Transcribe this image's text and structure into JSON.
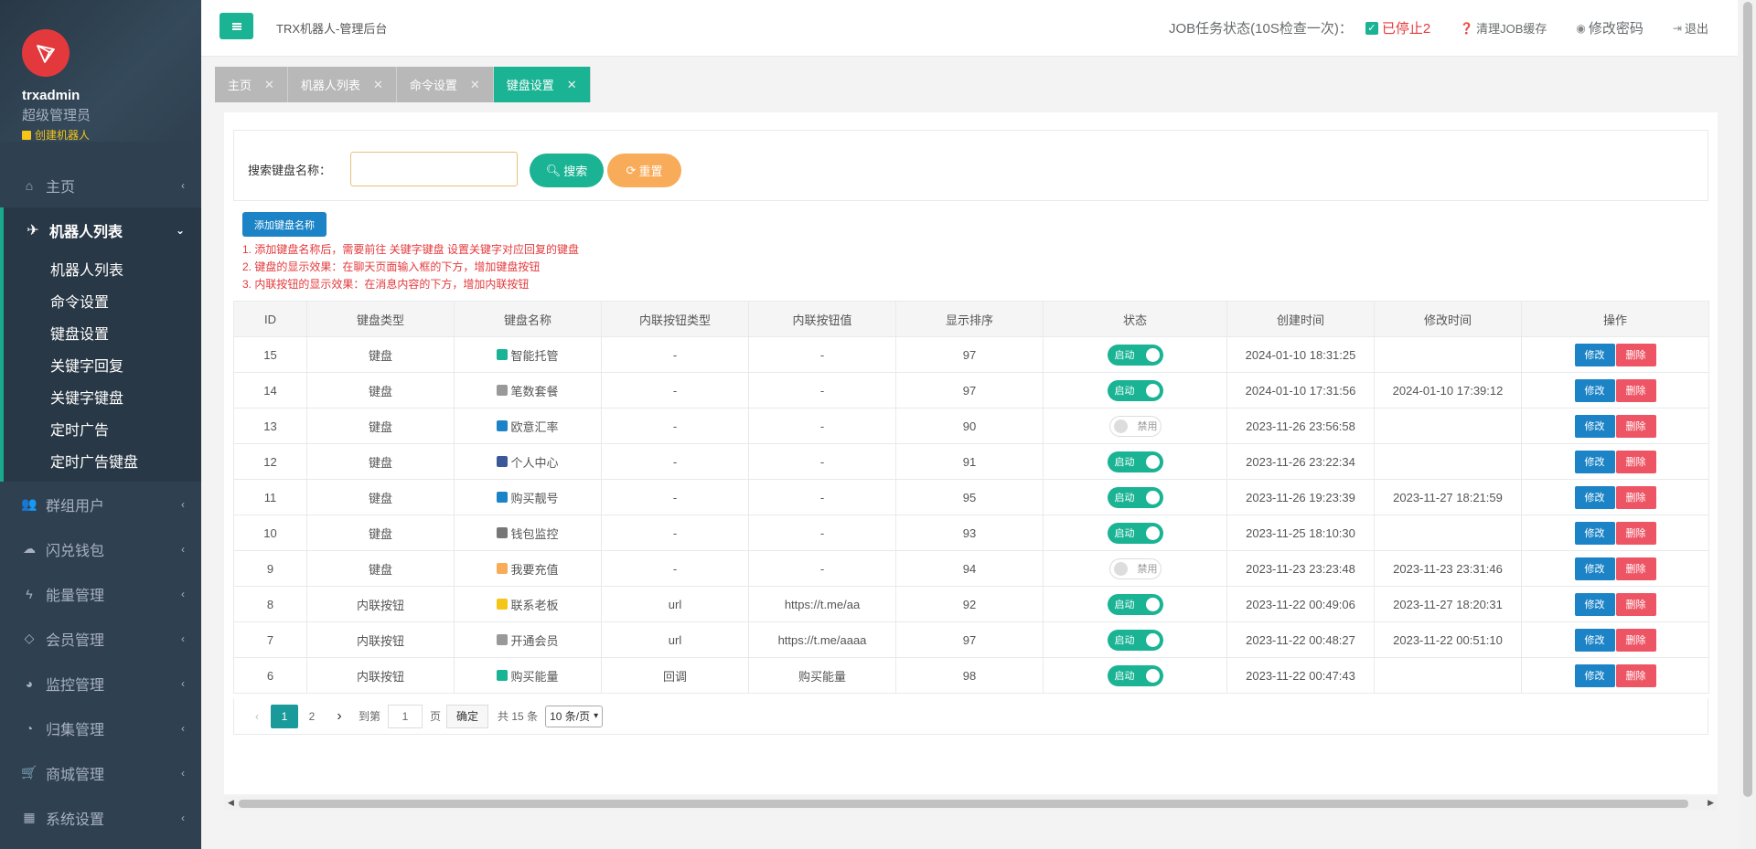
{
  "app": {
    "title": "TRX机器人-管理后台"
  },
  "profile": {
    "username": "trxadmin",
    "role": "超级管理员",
    "create_link": "创建机器人"
  },
  "sidebar": {
    "items": [
      {
        "label": "主页",
        "icon": "home-icon"
      },
      {
        "label": "机器人列表",
        "icon": "plane-icon",
        "active": true,
        "children": [
          "机器人列表",
          "命令设置",
          "键盘设置",
          "关键字回复",
          "关键字键盘",
          "定时广告",
          "定时广告键盘"
        ]
      },
      {
        "label": "群组用户",
        "icon": "users-icon"
      },
      {
        "label": "闪兑钱包",
        "icon": "cloud-icon"
      },
      {
        "label": "能量管理",
        "icon": "bolt-icon"
      },
      {
        "label": "会员管理",
        "icon": "diamond-icon"
      },
      {
        "label": "监控管理",
        "icon": "pie-icon"
      },
      {
        "label": "归集管理",
        "icon": "dashboard-icon"
      },
      {
        "label": "商城管理",
        "icon": "cart-icon"
      },
      {
        "label": "系统设置",
        "icon": "grid-icon"
      }
    ]
  },
  "topbar": {
    "job_status_label": "JOB任务状态(10S检查一次)：",
    "job_status_value": "已停止2",
    "clear_cache": "清理JOB缓存",
    "change_password": "修改密码",
    "logout": "退出"
  },
  "tabs": [
    "主页",
    "机器人列表",
    "命令设置",
    "键盘设置"
  ],
  "active_tab": "键盘设置",
  "search": {
    "label": "搜索键盘名称：",
    "placeholder": "",
    "search_btn": "搜索",
    "reset_btn": "重置"
  },
  "add_button": "添加键盘名称",
  "notes": [
    "1. 添加键盘名称后，需要前往 关键字键盘 设置关键字对应回复的键盘",
    "2. 键盘的显示效果：在聊天页面输入框的下方，增加键盘按钮",
    "3. 内联按钮的显示效果：在消息内容的下方，增加内联按钮"
  ],
  "table": {
    "columns": [
      "ID",
      "键盘类型",
      "键盘名称",
      "内联按钮类型",
      "内联按钮值",
      "显示排序",
      "状态",
      "创建时间",
      "修改时间",
      "操作"
    ],
    "rows": [
      {
        "id": "15",
        "type": "键盘",
        "name": "智能托管",
        "icon_color": "#1ab394",
        "btn_type": "-",
        "btn_value": "-",
        "sort": "97",
        "status": "启动",
        "on": true,
        "created": "2024-01-10 18:31:25",
        "modified": ""
      },
      {
        "id": "14",
        "type": "键盘",
        "name": "笔数套餐",
        "icon_color": "#999999",
        "btn_type": "-",
        "btn_value": "-",
        "sort": "97",
        "status": "启动",
        "on": true,
        "created": "2024-01-10 17:31:56",
        "modified": "2024-01-10 17:39:12"
      },
      {
        "id": "13",
        "type": "键盘",
        "name": "欧意汇率",
        "icon_color": "#1c84c6",
        "btn_type": "-",
        "btn_value": "-",
        "sort": "90",
        "status": "禁用",
        "on": false,
        "created": "2023-11-26 23:56:58",
        "modified": ""
      },
      {
        "id": "12",
        "type": "键盘",
        "name": "个人中心",
        "icon_color": "#3b5998",
        "btn_type": "-",
        "btn_value": "-",
        "sort": "91",
        "status": "启动",
        "on": true,
        "created": "2023-11-26 23:22:34",
        "modified": ""
      },
      {
        "id": "11",
        "type": "键盘",
        "name": "购买靓号",
        "icon_color": "#1c84c6",
        "btn_type": "-",
        "btn_value": "-",
        "sort": "95",
        "status": "启动",
        "on": true,
        "created": "2023-11-26 19:23:39",
        "modified": "2023-11-27 18:21:59"
      },
      {
        "id": "10",
        "type": "键盘",
        "name": "钱包监控",
        "icon_color": "#777777",
        "btn_type": "-",
        "btn_value": "-",
        "sort": "93",
        "status": "启动",
        "on": true,
        "created": "2023-11-25 18:10:30",
        "modified": ""
      },
      {
        "id": "9",
        "type": "键盘",
        "name": "我要充值",
        "icon_color": "#f8ac59",
        "btn_type": "-",
        "btn_value": "-",
        "sort": "94",
        "status": "禁用",
        "on": false,
        "created": "2023-11-23 23:23:48",
        "modified": "2023-11-23 23:31:46"
      },
      {
        "id": "8",
        "type": "内联按钮",
        "name": "联系老板",
        "icon_color": "#f5c518",
        "btn_type": "url",
        "btn_value": "https://t.me/aa",
        "sort": "92",
        "status": "启动",
        "on": true,
        "created": "2023-11-22 00:49:06",
        "modified": "2023-11-27 18:20:31"
      },
      {
        "id": "7",
        "type": "内联按钮",
        "name": "开通会员",
        "icon_color": "#999999",
        "btn_type": "url",
        "btn_value": "https://t.me/aaaa",
        "sort": "97",
        "status": "启动",
        "on": true,
        "created": "2023-11-22 00:48:27",
        "modified": "2023-11-22 00:51:10"
      },
      {
        "id": "6",
        "type": "内联按钮",
        "name": "购买能量",
        "icon_color": "#1ab394",
        "btn_type": "回调",
        "btn_value": "购买能量",
        "sort": "98",
        "status": "启动",
        "on": true,
        "created": "2023-11-22 00:47:43",
        "modified": ""
      }
    ],
    "edit_label": "修改",
    "delete_label": "删除"
  },
  "pagination": {
    "pages": [
      "1",
      "2"
    ],
    "current": "1",
    "goto_label": "到第",
    "goto_value": "1",
    "page_unit": "页",
    "confirm": "确定",
    "total": "共 15 条",
    "per_page": "10 条/页"
  }
}
